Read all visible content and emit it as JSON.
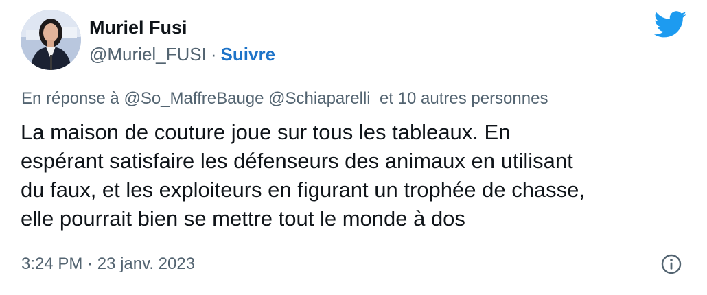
{
  "author": {
    "name": "Muriel Fusi",
    "handle": "@Muriel_FUSI",
    "separator": "·",
    "follow_label": "Suivre"
  },
  "reply": {
    "prefix": "En réponse à",
    "mention_1": "@So_MaffreBauge",
    "mention_2": "@Schiaparelli",
    "suffix": "et 10 autres personnes"
  },
  "body": {
    "lines": [
      "La maison de couture joue sur tous les tableaux. En",
      "espérant satisfaire les défenseurs des animaux en utilisant",
      "du faux, et les exploiteurs en figurant un trophée de chasse,",
      "elle pourrait bien se mettre tout le monde à dos"
    ]
  },
  "meta": {
    "time": "3:24 PM",
    "separator": "·",
    "date": "23 janv. 2023"
  },
  "icons": {
    "brand": "twitter-bird-icon",
    "info": "info-icon"
  },
  "colors": {
    "twitter_blue": "#1d9bf0",
    "follow_link": "#1d73c8",
    "secondary_text": "#536471",
    "primary_text": "#0f1419"
  }
}
